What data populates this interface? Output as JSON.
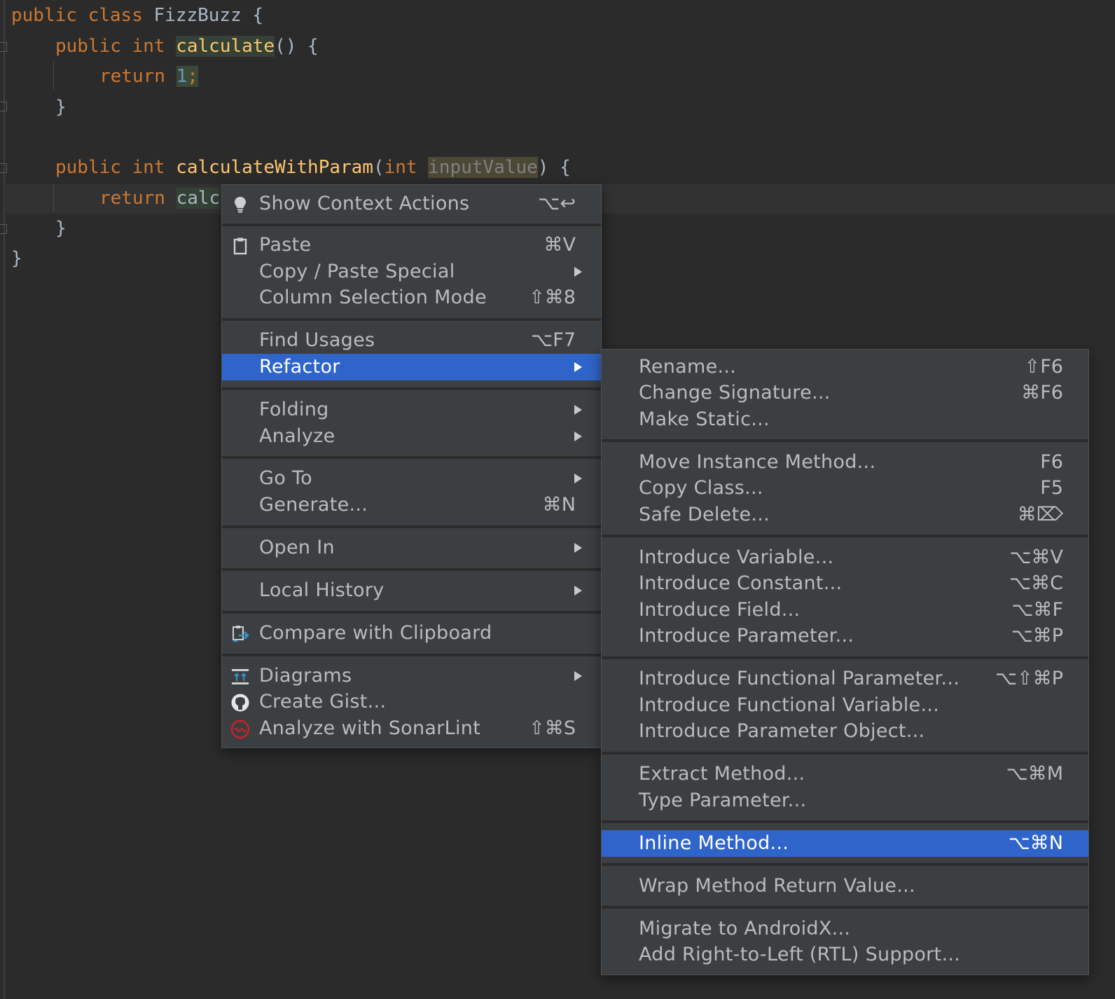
{
  "editor": {
    "line1": {
      "kw1": "public",
      "kw2": "class",
      "name": "FizzBuzz",
      "brace": "{"
    },
    "line2": {
      "kw1": "public",
      "kw2": "int",
      "fn": "calculate",
      "rest": "() {"
    },
    "line3": {
      "kw": "return",
      "num": "1",
      "semi": ";"
    },
    "line4": {
      "brace": "}"
    },
    "line6": {
      "kw1": "public",
      "kw2": "int",
      "fn": "calculateWithParam",
      "open": "(",
      "ptype": "int",
      "param": "inputValue",
      "rest": ") {"
    },
    "line7": {
      "kw": "return",
      "partial": "calc"
    },
    "line8": {
      "brace": "}"
    },
    "line9": {
      "brace": "}"
    }
  },
  "context_menu": {
    "show_context_actions": {
      "label": "Show Context Actions",
      "shortcut": "⌥↩",
      "icon": "lightbulb-icon"
    },
    "paste": {
      "label": "Paste",
      "shortcut": "⌘V",
      "icon": "clipboard-icon"
    },
    "copy_paste_special": {
      "label": "Copy / Paste Special"
    },
    "column_selection_mode": {
      "label": "Column Selection Mode",
      "shortcut": "⇧⌘8"
    },
    "find_usages": {
      "label": "Find Usages",
      "shortcut": "⌥F7"
    },
    "refactor": {
      "label": "Refactor"
    },
    "folding": {
      "label": "Folding"
    },
    "analyze": {
      "label": "Analyze"
    },
    "go_to": {
      "label": "Go To"
    },
    "generate": {
      "label": "Generate...",
      "shortcut": "⌘N"
    },
    "open_in": {
      "label": "Open In"
    },
    "local_history": {
      "label": "Local History"
    },
    "compare_with_clipboard": {
      "label": "Compare with Clipboard",
      "icon": "compare-icon"
    },
    "diagrams": {
      "label": "Diagrams",
      "icon": "diagram-icon"
    },
    "create_gist": {
      "label": "Create Gist...",
      "icon": "github-icon"
    },
    "analyze_sonarlint": {
      "label": "Analyze with SonarLint",
      "shortcut": "⇧⌘S",
      "icon": "sonarlint-icon"
    }
  },
  "refactor_menu": {
    "rename": {
      "label": "Rename...",
      "shortcut": "⇧F6"
    },
    "change_signature": {
      "label": "Change Signature...",
      "shortcut": "⌘F6"
    },
    "make_static": {
      "label": "Make Static..."
    },
    "move_instance_method": {
      "label": "Move Instance Method...",
      "shortcut": "F6"
    },
    "copy_class": {
      "label": "Copy Class...",
      "shortcut": "F5"
    },
    "safe_delete": {
      "label": "Safe Delete...",
      "shortcut": "⌘⌦"
    },
    "introduce_variable": {
      "label": "Introduce Variable...",
      "shortcut": "⌥⌘V"
    },
    "introduce_constant": {
      "label": "Introduce Constant...",
      "shortcut": "⌥⌘C"
    },
    "introduce_field": {
      "label": "Introduce Field...",
      "shortcut": "⌥⌘F"
    },
    "introduce_parameter": {
      "label": "Introduce Parameter...",
      "shortcut": "⌥⌘P"
    },
    "introduce_functional_parameter": {
      "label": "Introduce Functional Parameter...",
      "shortcut": "⌥⇧⌘P"
    },
    "introduce_functional_variable": {
      "label": "Introduce Functional Variable..."
    },
    "introduce_parameter_object": {
      "label": "Introduce Parameter Object..."
    },
    "extract_method": {
      "label": "Extract Method...",
      "shortcut": "⌥⌘M"
    },
    "type_parameter": {
      "label": "Type Parameter..."
    },
    "inline_method": {
      "label": "Inline Method...",
      "shortcut": "⌥⌘N"
    },
    "wrap_method_return_value": {
      "label": "Wrap Method Return Value..."
    },
    "migrate_androidx": {
      "label": "Migrate to AndroidX..."
    },
    "add_rtl_support": {
      "label": "Add Right-to-Left (RTL) Support..."
    }
  },
  "colors": {
    "editor_bg": "#2b2b2b",
    "menu_bg": "#3c3f41",
    "selection": "#2f65ca",
    "keyword": "#cc7832",
    "function": "#ffc66d",
    "number": "#6897bb"
  }
}
